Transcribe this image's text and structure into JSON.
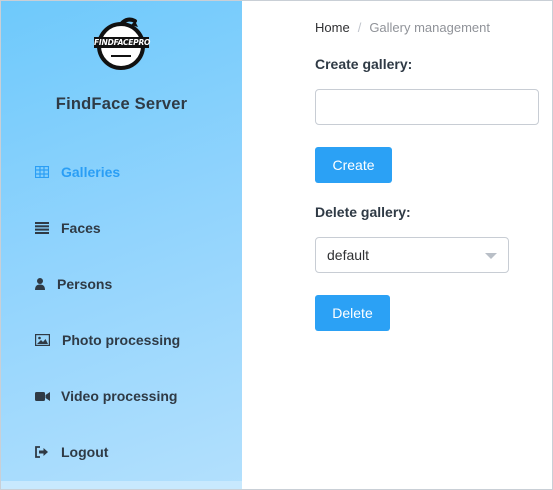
{
  "app": {
    "logo_text": "FINDFACEPRO",
    "title": "FindFace Server"
  },
  "colors": {
    "accent": "#2ba1f5",
    "sidebar_gradient_start": "#6ec9fb",
    "sidebar_gradient_end": "#b3e0fd",
    "active_nav": "#2a9ef5"
  },
  "sidebar": {
    "items": [
      {
        "label": "Galleries",
        "icon": "table-icon",
        "active": true
      },
      {
        "label": "Faces",
        "icon": "list-icon",
        "active": false
      },
      {
        "label": "Persons",
        "icon": "user-icon",
        "active": false
      },
      {
        "label": "Photo processing",
        "icon": "image-icon",
        "active": false
      },
      {
        "label": "Video processing",
        "icon": "video-camera-icon",
        "active": false
      },
      {
        "label": "Logout",
        "icon": "sign-out-icon",
        "active": false
      }
    ]
  },
  "breadcrumb": {
    "home": "Home",
    "separator": "/",
    "current": "Gallery management"
  },
  "create": {
    "label": "Create gallery:",
    "input_value": "",
    "input_placeholder": "",
    "button": "Create"
  },
  "delete": {
    "label": "Delete gallery:",
    "selected": "default",
    "button": "Delete"
  }
}
